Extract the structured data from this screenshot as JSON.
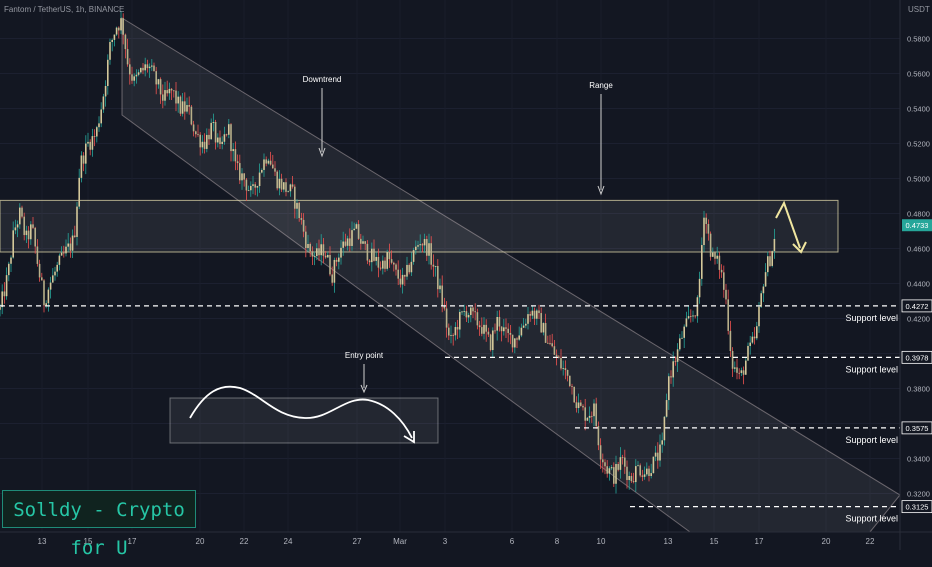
{
  "header": {
    "symbol_title": "Fantom / TetherUS, 1h, BINANCE",
    "unit": "USDT"
  },
  "brand": {
    "label": "Solldy - Crypto for U"
  },
  "colors": {
    "background": "#131722",
    "candle_up": "#26a69a",
    "candle_down": "#ef5350",
    "candle_body_neutral": "#d4c89a",
    "annotation": "#ffffff",
    "arrow_yellow": "#f0e6a0",
    "price_tag": "#26a69a"
  },
  "chart_data": {
    "type": "candlestick",
    "title": "Fantom / TetherUS, 1h, BINANCE",
    "ylabel": "USDT",
    "ylim": [
      0.298,
      0.598
    ],
    "grid": true,
    "x_ticks": [
      "13",
      "15",
      "17",
      "20",
      "22",
      "24",
      "27",
      "Mar",
      "3",
      "6",
      "8",
      "10",
      "13",
      "15",
      "17",
      "20",
      "22"
    ],
    "y_ticks": [
      "0.5800",
      "0.5600",
      "0.5400",
      "0.5200",
      "0.5000",
      "0.4800",
      "0.4600",
      "0.4400",
      "0.4200",
      "0.4000",
      "0.3800",
      "0.3600",
      "0.3400",
      "0.3200"
    ],
    "series_path": [
      [
        0,
        0.425
      ],
      [
        8,
        0.445
      ],
      [
        14,
        0.47
      ],
      [
        20,
        0.48
      ],
      [
        26,
        0.465
      ],
      [
        32,
        0.472
      ],
      [
        38,
        0.45
      ],
      [
        44,
        0.43
      ],
      [
        50,
        0.44
      ],
      [
        58,
        0.45
      ],
      [
        66,
        0.458
      ],
      [
        74,
        0.465
      ],
      [
        80,
        0.508
      ],
      [
        88,
        0.52
      ],
      [
        96,
        0.525
      ],
      [
        104,
        0.55
      ],
      [
        110,
        0.575
      ],
      [
        116,
        0.587
      ],
      [
        122,
        0.59
      ],
      [
        128,
        0.565
      ],
      [
        134,
        0.555
      ],
      [
        140,
        0.56
      ],
      [
        148,
        0.565
      ],
      [
        156,
        0.555
      ],
      [
        164,
        0.545
      ],
      [
        172,
        0.55
      ],
      [
        180,
        0.54
      ],
      [
        188,
        0.54
      ],
      [
        196,
        0.525
      ],
      [
        204,
        0.52
      ],
      [
        212,
        0.53
      ],
      [
        220,
        0.515
      ],
      [
        228,
        0.53
      ],
      [
        236,
        0.505
      ],
      [
        244,
        0.5
      ],
      [
        252,
        0.49
      ],
      [
        260,
        0.505
      ],
      [
        268,
        0.515
      ],
      [
        276,
        0.5
      ],
      [
        284,
        0.495
      ],
      [
        292,
        0.492
      ],
      [
        300,
        0.478
      ],
      [
        308,
        0.46
      ],
      [
        316,
        0.455
      ],
      [
        324,
        0.46
      ],
      [
        332,
        0.445
      ],
      [
        340,
        0.46
      ],
      [
        348,
        0.465
      ],
      [
        356,
        0.47
      ],
      [
        364,
        0.46
      ],
      [
        372,
        0.455
      ],
      [
        380,
        0.45
      ],
      [
        388,
        0.455
      ],
      [
        396,
        0.445
      ],
      [
        404,
        0.44
      ],
      [
        412,
        0.455
      ],
      [
        420,
        0.465
      ],
      [
        428,
        0.46
      ],
      [
        436,
        0.445
      ],
      [
        444,
        0.425
      ],
      [
        450,
        0.405
      ],
      [
        458,
        0.418
      ],
      [
        466,
        0.425
      ],
      [
        474,
        0.42
      ],
      [
        482,
        0.415
      ],
      [
        490,
        0.405
      ],
      [
        498,
        0.42
      ],
      [
        506,
        0.41
      ],
      [
        514,
        0.408
      ],
      [
        522,
        0.415
      ],
      [
        530,
        0.425
      ],
      [
        538,
        0.42
      ],
      [
        546,
        0.41
      ],
      [
        554,
        0.4
      ],
      [
        562,
        0.392
      ],
      [
        570,
        0.385
      ],
      [
        578,
        0.37
      ],
      [
        586,
        0.365
      ],
      [
        594,
        0.368
      ],
      [
        600,
        0.345
      ],
      [
        606,
        0.335
      ],
      [
        614,
        0.33
      ],
      [
        622,
        0.34
      ],
      [
        630,
        0.328
      ],
      [
        638,
        0.335
      ],
      [
        646,
        0.332
      ],
      [
        654,
        0.338
      ],
      [
        662,
        0.345
      ],
      [
        668,
        0.385
      ],
      [
        676,
        0.398
      ],
      [
        682,
        0.41
      ],
      [
        690,
        0.42
      ],
      [
        698,
        0.428
      ],
      [
        704,
        0.482
      ],
      [
        712,
        0.455
      ],
      [
        720,
        0.45
      ],
      [
        726,
        0.43
      ],
      [
        732,
        0.395
      ],
      [
        740,
        0.385
      ],
      [
        748,
        0.4
      ],
      [
        756,
        0.41
      ],
      [
        764,
        0.445
      ],
      [
        770,
        0.455
      ],
      [
        776,
        0.468
      ]
    ],
    "current_price": "0.4733",
    "range_zone": {
      "top": 0.4875,
      "bottom": 0.458,
      "label": "Range"
    },
    "support_levels": [
      {
        "price": "0.4272",
        "label": "Support level"
      },
      {
        "price": "0.3978",
        "label": "Support level"
      },
      {
        "price": "0.3575",
        "label": "Support level"
      },
      {
        "price": "0.3125",
        "label": "Support level"
      }
    ],
    "annotations": {
      "downtrend": "Downtrend",
      "range": "Range",
      "entry_point": "Entry point"
    }
  }
}
